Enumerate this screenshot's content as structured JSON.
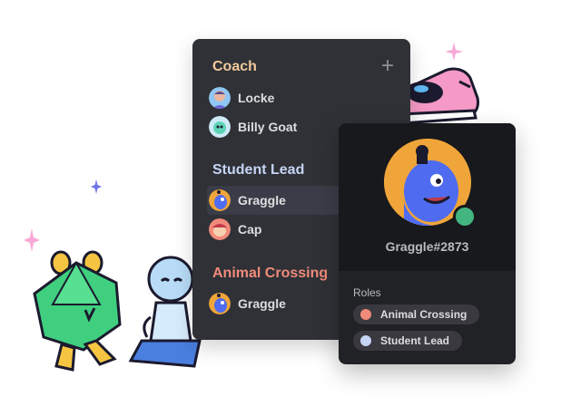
{
  "colors": {
    "coach": "#f2c99c",
    "student_lead": "#c6d4f5",
    "animal_crossing": "#f08a7a",
    "online_status": "#43b581"
  },
  "categories": [
    {
      "title": "Coach",
      "members": [
        {
          "name": "Locke",
          "avatar": "locke-avatar"
        },
        {
          "name": "Billy Goat",
          "avatar": "billy-goat-avatar"
        }
      ]
    },
    {
      "title": "Student Lead",
      "members": [
        {
          "name": "Graggle",
          "avatar": "graggle-avatar",
          "selected": true
        },
        {
          "name": "Cap",
          "avatar": "cap-avatar"
        }
      ]
    },
    {
      "title": "Animal Crossing",
      "members": [
        {
          "name": "Graggle",
          "avatar": "graggle-avatar"
        }
      ]
    }
  ],
  "add_icon": "plus-icon",
  "profile": {
    "username": "Graggle#2873",
    "roles_label": "Roles",
    "roles": [
      {
        "name": "Animal Crossing",
        "color": "#f08a7a"
      },
      {
        "name": "Student Lead",
        "color": "#c6d4f5"
      }
    ]
  }
}
